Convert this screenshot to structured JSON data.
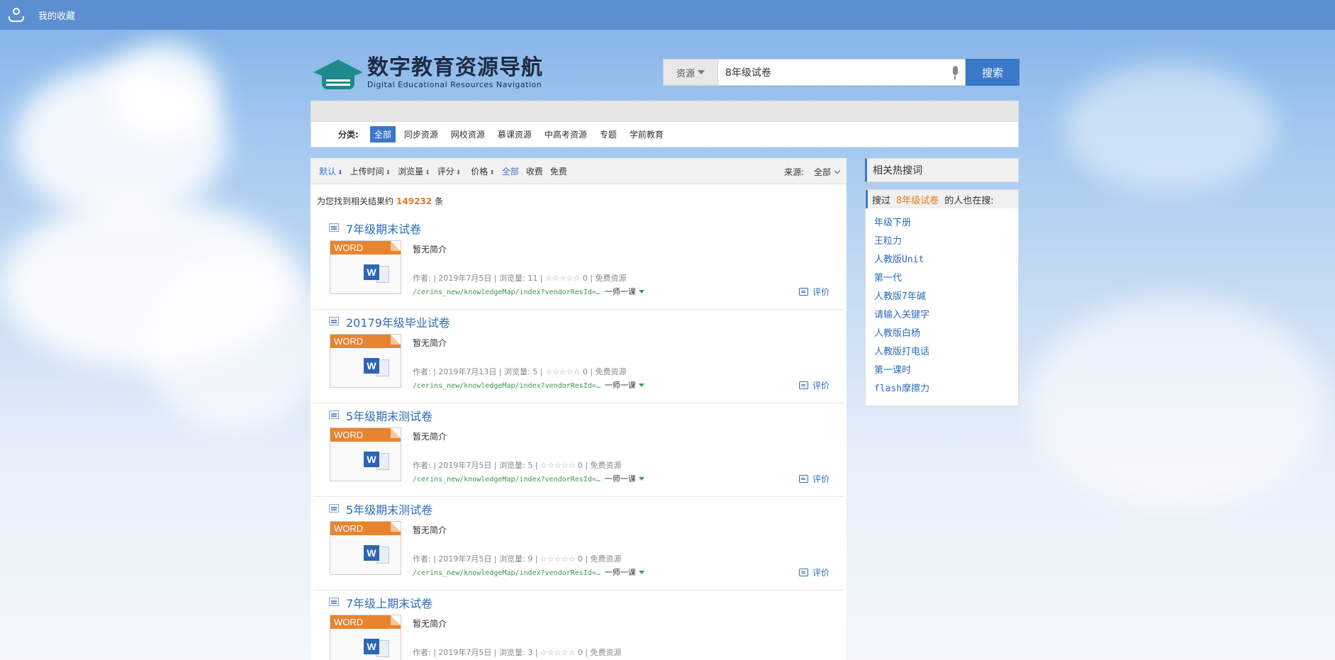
{
  "topbar": {
    "favorites": "我的收藏"
  },
  "logo": {
    "title_cn": "数字教育资源导航",
    "title_en": "Digital Educational Resources Navigation"
  },
  "search": {
    "type": "资源",
    "query": "8年级试卷",
    "button": "搜索"
  },
  "categories": {
    "label": "分类:",
    "items": [
      "全部",
      "同步资源",
      "网校资源",
      "慕课资源",
      "中高考资源",
      "专题",
      "学前教育"
    ],
    "active": "全部"
  },
  "sort": {
    "items": [
      "默认",
      "上传时间",
      "浏览量",
      "评分",
      "价格",
      "全部",
      "收费",
      "免费"
    ],
    "source_label": "来源:",
    "source_value": "全部"
  },
  "result_count": {
    "prefix": "为您找到相关结果约",
    "count": "149232",
    "suffix": "条"
  },
  "results": [
    {
      "title": "7年级期末试卷",
      "desc": "暂无简介",
      "date": "2019年7月5日",
      "views": "11",
      "score": "0",
      "price": "免费资源",
      "path": "/cerins_new/knowledgeMap/index?vendorResId=…",
      "source": "一师一课",
      "thumb_label": "WORD",
      "review": "评价"
    },
    {
      "title": "20179年级毕业试卷",
      "desc": "暂无简介",
      "date": "2019年7月13日",
      "views": "5",
      "score": "0",
      "price": "免费资源",
      "path": "/cerins_new/knowledgeMap/index?vendorResId=…",
      "source": "一师一课",
      "thumb_label": "WORD",
      "review": "评价"
    },
    {
      "title": "5年级期末测试卷",
      "desc": "暂无简介",
      "date": "2019年7月5日",
      "views": "5",
      "score": "0",
      "price": "免费资源",
      "path": "/cerins_new/knowledgeMap/index?vendorResId=…",
      "source": "一师一课",
      "thumb_label": "WORD",
      "review": "评价"
    },
    {
      "title": "5年级期末测试卷",
      "desc": "暂无简介",
      "date": "2019年7月5日",
      "views": "9",
      "score": "0",
      "price": "免费资源",
      "path": "/cerins_new/knowledgeMap/index?vendorResId=…",
      "source": "一师一课",
      "thumb_label": "WORD",
      "review": "评价"
    },
    {
      "title": "7年级上期末试卷",
      "desc": "暂无简介",
      "date": "2019年7月5日",
      "views": "3",
      "score": "0",
      "price": "免费资源",
      "path": "",
      "source": "",
      "thumb_label": "WORD",
      "review": ""
    }
  ],
  "labels": {
    "author": "作者:",
    "views": "浏览量:"
  },
  "sidebar": {
    "hot_title": "相关热搜词",
    "also_prefix": "搜过",
    "also_keyword": "8年级试卷",
    "also_suffix": "的人也在搜:",
    "terms": [
      "年级下册",
      "王粒力",
      "人教版Unit",
      "第一代",
      "人教版7年碱",
      "请输入关键字",
      "人教版白杨",
      "人教版打电话",
      "第一课时",
      "flash摩擦力"
    ]
  }
}
